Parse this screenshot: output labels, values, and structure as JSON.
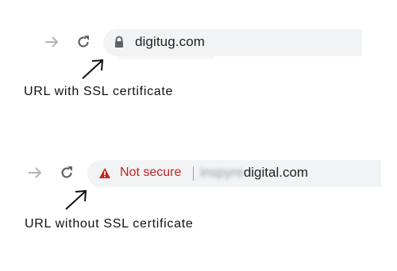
{
  "secure_example": {
    "url": "digitug.com",
    "caption": "URL with SSL certificate",
    "icons": {
      "forward": "forward-arrow-icon",
      "reload": "reload-icon",
      "lock": "lock-icon"
    }
  },
  "insecure_example": {
    "status": "Not secure",
    "separator": "|",
    "url_blurred_part": "inspyre",
    "url_visible_part": "digital.com",
    "caption": "URL without SSL certificate",
    "icons": {
      "forward": "forward-arrow-icon",
      "reload": "reload-icon",
      "warning": "warning-triangle-icon"
    }
  },
  "colors": {
    "address_bar": "#f1f3f4",
    "not_secure_red": "#c5221f",
    "icon_gray": "#5f6368",
    "disabled_gray": "#b0b4b8",
    "text": "#202124"
  }
}
